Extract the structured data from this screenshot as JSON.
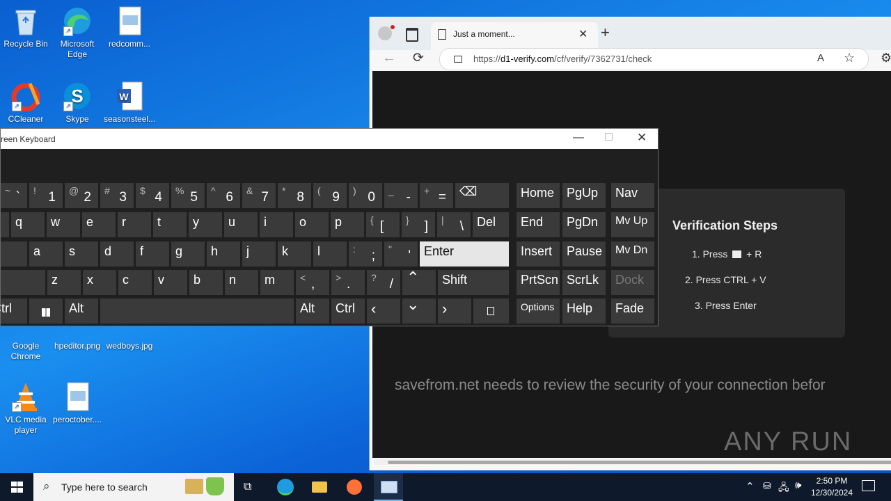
{
  "desktop": {
    "icons": [
      {
        "label": "Recycle Bin"
      },
      {
        "label": "Microsoft Edge"
      },
      {
        "label": "redcomm..."
      },
      {
        "label": "CCleaner"
      },
      {
        "label": "Skype"
      },
      {
        "label": "seasonsteel..."
      },
      {
        "label": "Google Chrome"
      },
      {
        "label": "hpeditor.png"
      },
      {
        "label": "wedboys.jpg"
      },
      {
        "label": "VLC media player"
      },
      {
        "label": "peroctober...."
      }
    ]
  },
  "browser": {
    "tab_title": "Just a moment...",
    "url_prefix": "https://",
    "url_host": "d1-verify.com",
    "url_path": "/cf/verify/7362731/check",
    "verification": {
      "title": "Verification Steps",
      "step1_a": "1. Press",
      "step1_b": "+ R",
      "step2": "2. Press CTRL + V",
      "step3": "3. Press Enter"
    },
    "message": "savefrom.net needs to review the security of your connection befor",
    "watermark": "ANY RUN"
  },
  "osk": {
    "title": "reen Keyboard",
    "keys": {
      "backtick": {
        "sub": "~",
        "main": "`"
      },
      "k1": {
        "sub": "!",
        "main": "1"
      },
      "k2": {
        "sub": "@",
        "main": "2"
      },
      "k3": {
        "sub": "#",
        "main": "3"
      },
      "k4": {
        "sub": "$",
        "main": "4"
      },
      "k5": {
        "sub": "%",
        "main": "5"
      },
      "k6": {
        "sub": "^",
        "main": "6"
      },
      "k7": {
        "sub": "&",
        "main": "7"
      },
      "k8": {
        "sub": "*",
        "main": "8"
      },
      "k9": {
        "sub": "(",
        "main": "9"
      },
      "k0": {
        "sub": ")",
        "main": "0"
      },
      "minus": {
        "sub": "_",
        "main": "-"
      },
      "equals": {
        "sub": "+",
        "main": "="
      },
      "q": "q",
      "w": "w",
      "e": "e",
      "r": "r",
      "t": "t",
      "y": "y",
      "u": "u",
      "i": "i",
      "o": "o",
      "p": "p",
      "lbracket": {
        "sub": "{",
        "main": "["
      },
      "rbracket": {
        "sub": "}",
        "main": "]"
      },
      "backslash": {
        "sub": "|",
        "main": "\\"
      },
      "del": "Del",
      "a": "a",
      "s": "s",
      "d": "d",
      "f": "f",
      "g": "g",
      "h": "h",
      "j": "j",
      "k": "k",
      "l": "l",
      "semicolon": {
        "sub": ":",
        "main": ";"
      },
      "quote": {
        "sub": "\"",
        "main": "'"
      },
      "enter": "Enter",
      "z": "z",
      "x": "x",
      "c": "c",
      "v": "v",
      "b": "b",
      "n": "n",
      "m": "m",
      "comma": {
        "sub": "<",
        "main": ","
      },
      "period": {
        "sub": ">",
        "main": "."
      },
      "slash": {
        "sub": "?",
        "main": "/"
      },
      "shift": "Shift",
      "ctrl_left": "Ctrl",
      "alt_left": "Alt",
      "alt_right": "Alt",
      "ctrl_right": "Ctrl",
      "home": "Home",
      "pgup": "PgUp",
      "nav": "Nav",
      "end": "End",
      "pgdn": "PgDn",
      "mvup": "Mv Up",
      "insert": "Insert",
      "pause": "Pause",
      "mvdn": "Mv Dn",
      "prtscn": "PrtScn",
      "scrlk": "ScrLk",
      "dock": "Dock",
      "options": "Options",
      "help": "Help",
      "fade": "Fade"
    }
  },
  "taskbar": {
    "search_placeholder": "Type here to search",
    "time": "2:50 PM",
    "date": "12/30/2024"
  },
  "colors": {
    "desktop_blue": "#1a8ff0",
    "taskbar": "#0e1a2b",
    "key": "#3a3a3a",
    "page_bg": "#191919"
  }
}
